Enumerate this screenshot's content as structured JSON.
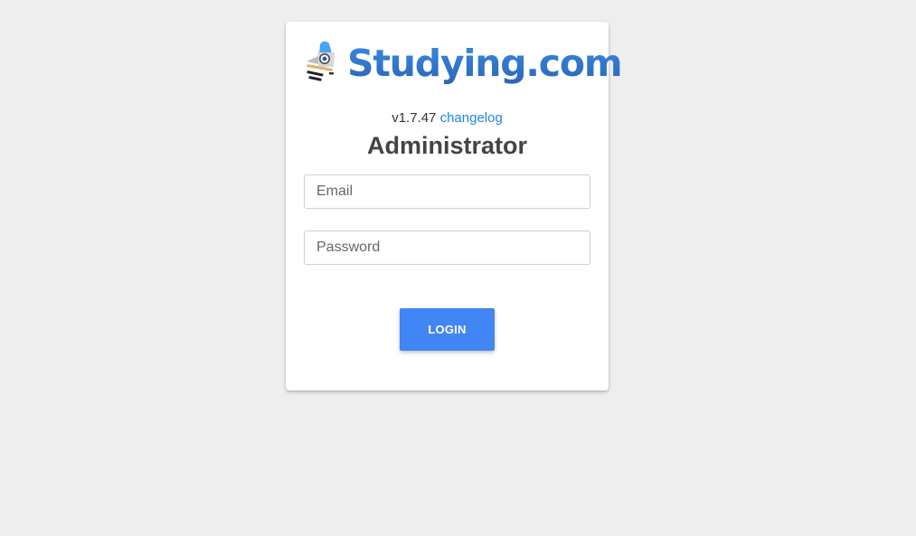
{
  "brand": {
    "name": "Studying.com",
    "logo_icon": "rocket-icon",
    "colors": {
      "text_top": "#3a8ee0",
      "text_bottom": "#2a62b8",
      "rocket_blue": "#42a5f5",
      "rocket_body": "#9e9e9e"
    }
  },
  "header": {
    "version": "v1.7.47",
    "changelog_link": "changelog",
    "title": "Administrator"
  },
  "form": {
    "email": {
      "placeholder": "Email",
      "value": ""
    },
    "password": {
      "placeholder": "Password",
      "value": ""
    },
    "login_label": "LOGIN"
  },
  "colors": {
    "page_background": "#eeeeee",
    "card_background": "#ffffff",
    "link": "#1e88e5",
    "primary_button": "#4285f4"
  }
}
